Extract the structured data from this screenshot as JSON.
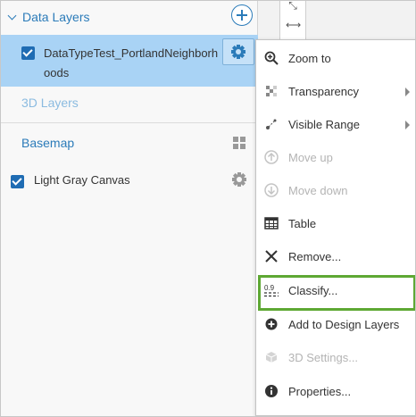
{
  "panel": {
    "data_layers_title": "Data Layers",
    "selected_layer_name": "DataTypeTest_PortlandNeighborhoods",
    "three_d_layers_title": "3D Layers",
    "basemap_title": "Basemap",
    "basemap_layer_name": "Light Gray Canvas"
  },
  "menu": {
    "items": [
      {
        "label": "Zoom to",
        "icon": "zoom-in-icon",
        "disabled": false
      },
      {
        "label": "Transparency",
        "icon": "transparency-icon",
        "disabled": false,
        "submenu": true
      },
      {
        "label": "Visible Range",
        "icon": "visible-range-icon",
        "disabled": false,
        "submenu": true
      },
      {
        "label": "Move up",
        "icon": "arrow-up-circle-icon",
        "disabled": true
      },
      {
        "label": "Move down",
        "icon": "arrow-down-circle-icon",
        "disabled": true
      },
      {
        "label": "Table",
        "icon": "table-icon",
        "disabled": false
      },
      {
        "label": "Remove...",
        "icon": "close-icon",
        "disabled": false
      },
      {
        "label": "Classify...",
        "icon": "classify-icon",
        "disabled": false,
        "highlighted": true
      },
      {
        "label": "Add to Design Layers",
        "icon": "add-circle-icon",
        "disabled": false
      },
      {
        "label": "3D Settings...",
        "icon": "cube-icon",
        "disabled": true
      },
      {
        "label": "Properties...",
        "icon": "info-icon",
        "disabled": false
      }
    ]
  },
  "colors": {
    "accent": "#2b7bb9",
    "selected_row": "#a9d3f5",
    "highlight_border": "#5ea833",
    "disabled_text": "#b4b4b4"
  }
}
